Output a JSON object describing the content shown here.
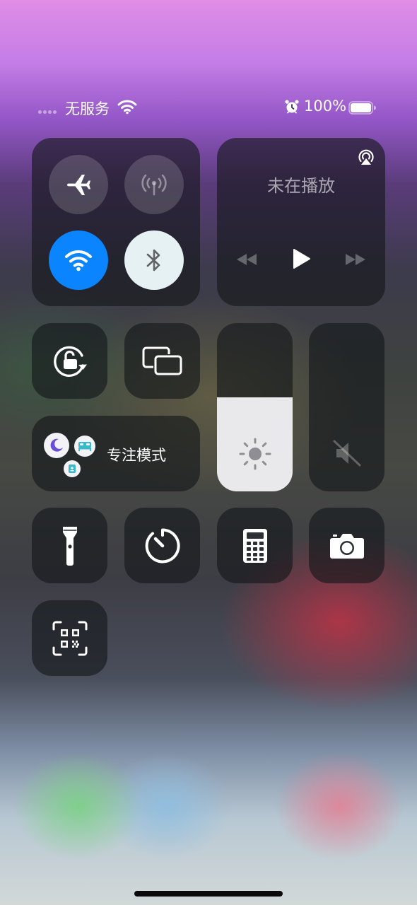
{
  "status_bar": {
    "carrier": "无服务",
    "battery_percent": "100%",
    "battery_level": 1.0,
    "icons": [
      "signal-dots-icon",
      "wifi-icon",
      "alarm-icon",
      "battery-icon"
    ]
  },
  "connectivity": {
    "airplane_mode": false,
    "cellular_data": false,
    "wifi": true,
    "bluetooth": true,
    "icons": [
      "airplane-icon",
      "cellular-antenna-icon",
      "wifi-icon",
      "bluetooth-icon"
    ]
  },
  "media": {
    "title": "未在播放",
    "icons": [
      "airplay-icon",
      "rewind-icon",
      "play-icon",
      "fast-forward-icon"
    ]
  },
  "focus": {
    "label": "专注模式",
    "icons": [
      "moon-icon",
      "bed-icon",
      "badge-icon"
    ]
  },
  "brightness": {
    "level": 0.56,
    "icon": "sun-icon"
  },
  "volume": {
    "level": 0.0,
    "icon": "speaker-muted-icon"
  },
  "shortcuts": [
    "flashlight-icon",
    "timer-icon",
    "calculator-icon",
    "camera-icon",
    "qr-code-scanner-icon",
    "orientation-lock-icon",
    "screen-mirroring-icon"
  ],
  "colors": {
    "accent_blue": "#0a84ff",
    "bluetooth_bg": "#e6f1f4",
    "focus_purple": "#6a4ed6",
    "focus_teal": "#3ab9c9"
  }
}
